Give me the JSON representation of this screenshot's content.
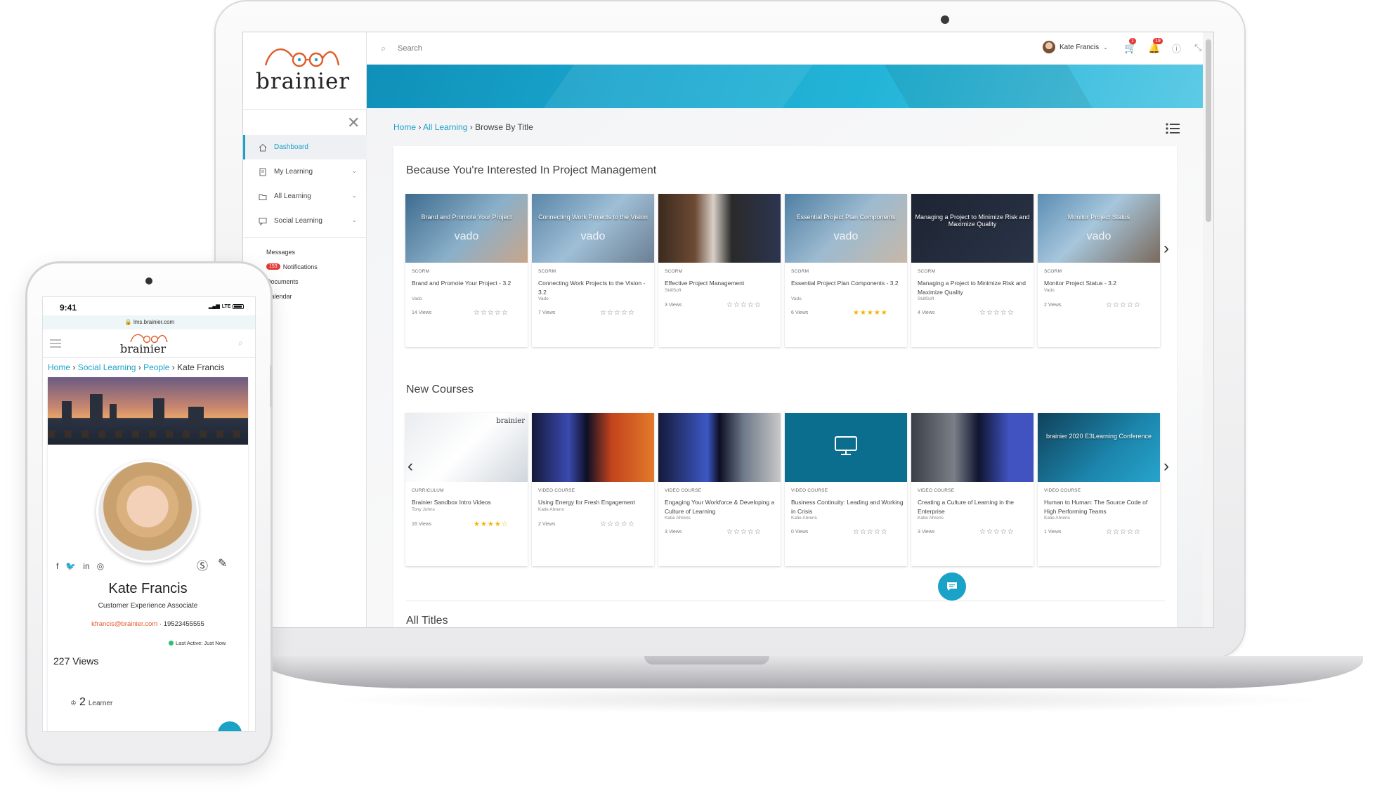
{
  "desktop": {
    "logo_text": "brainier",
    "search_placeholder": "Search",
    "user_name": "Kate Francis",
    "cart_badge": "1",
    "bell_badge": "19",
    "sidebar": {
      "items": [
        {
          "label": "Dashboard"
        },
        {
          "label": "My Learning"
        },
        {
          "label": "All Learning"
        },
        {
          "label": "Social Learning"
        }
      ],
      "messages": "Messages",
      "notifications_badge": "153",
      "notifications": "Notifications",
      "documents": "Documents",
      "calendar": "Calendar"
    },
    "breadcrumb": {
      "home": "Home",
      "all_learning": "All Learning",
      "current": "Browse By Title"
    },
    "section1": {
      "title": "Because You're Interested In Project Management",
      "cards": [
        {
          "caption": "Brand and Promote Your Project",
          "vado": "vado",
          "type": "SCORM",
          "title": "Brand and Promote Your Project - 3.2",
          "provider": "Vado",
          "views": "14 Views",
          "stars": "☆☆☆☆☆",
          "gold": false,
          "bg": "linear-gradient(135deg,#3d6b8f,#8bb0c9 55%,#c9a58a)"
        },
        {
          "caption": "Connecting Work Projects to the Vision",
          "vado": "vado",
          "type": "SCORM",
          "title": "Connecting Work Projects to the Vision - 3.2",
          "provider": "Vado",
          "views": "7 Views",
          "stars": "☆☆☆☆☆",
          "gold": false,
          "bg": "linear-gradient(135deg,#5a86a8,#9fbfd6 50%,#6b7f93)"
        },
        {
          "caption": "",
          "vado": "",
          "type": "SCORM",
          "title": "Effective Project Management",
          "provider": "SkillSoft",
          "views": "3 Views",
          "stars": "☆☆☆☆☆",
          "gold": false,
          "bg": "linear-gradient(90deg,#3b2a1e,#6d4a34 30%,#d8d0c8 45%,#2a2a2a 60%,#2c3550)"
        },
        {
          "caption": "Essential Project Plan Components",
          "vado": "vado",
          "type": "SCORM",
          "title": "Essential Project Plan Components - 3.2",
          "provider": "Vado",
          "views": "6 Views",
          "stars": "★★★★★",
          "gold": true,
          "bg": "linear-gradient(135deg,#4f7fa3,#9cbad0 50%,#c8b8a8)"
        },
        {
          "caption": "Managing a Project to Minimize Risk and Maximize Quality",
          "vado": "",
          "type": "SCORM",
          "title": "Managing a Project to Minimize Risk and Maximize Quality",
          "provider": "SkillSoft",
          "views": "4 Views",
          "stars": "☆☆☆☆☆",
          "gold": false,
          "bg": "linear-gradient(135deg,#1d2433,#2a3447)"
        },
        {
          "caption": "Monitor Project Status",
          "vado": "vado",
          "type": "SCORM",
          "title": "Monitor Project Status - 3.2",
          "provider": "Vado",
          "views": "2 Views",
          "stars": "☆☆☆☆☆",
          "gold": false,
          "bg": "linear-gradient(135deg,#5b8db3,#a6c6dc 45%,#7a6a5c)"
        }
      ]
    },
    "section2": {
      "title": "New Courses",
      "cards": [
        {
          "caption": "",
          "vado": "",
          "type": "CURRICULUM",
          "title": "Brainier Sandbox Intro Videos",
          "provider": "Tony Johns",
          "views": "16 Views",
          "stars": "★★★★☆",
          "gold": true,
          "bg": "linear-gradient(135deg,#e9ecef,#ffffff 50%,#cfd6dc)"
        },
        {
          "caption": "",
          "vado": "",
          "type": "VIDEO COURSE",
          "title": "Using Energy for Fresh Engagement",
          "provider": "Katie Ahrens",
          "views": "2 Views",
          "stars": "☆☆☆☆☆",
          "gold": false,
          "bg": "linear-gradient(90deg,#141a3a,#3a4ab0 30%,#0d0f24 45%,#c2431d 65%,#e37a2a)"
        },
        {
          "caption": "",
          "vado": "",
          "type": "VIDEO COURSE",
          "title": "Engaging Your Workforce & Developing a Culture of Learning",
          "provider": "Katie Ahrens",
          "views": "3 Views",
          "stars": "☆☆☆☆☆",
          "gold": false,
          "bg": "linear-gradient(90deg,#141a3a,#3d58c4 40%,#0d0f24 50%,#6f7a8a 70%,#c8c8c8)"
        },
        {
          "caption": "",
          "vado": "",
          "type": "VIDEO COURSE",
          "title": "Business Continuity: Leading and Working in Crisis",
          "provider": "Katie Ahrens",
          "views": "0 Views",
          "stars": "☆☆☆☆☆",
          "gold": false,
          "bg": "#0c6e8e"
        },
        {
          "caption": "",
          "vado": "",
          "type": "VIDEO COURSE",
          "title": "Creating a Culture of Learning in the Enterprise",
          "provider": "Katie Ahrens",
          "views": "3 Views",
          "stars": "☆☆☆☆☆",
          "gold": false,
          "bg": "linear-gradient(90deg,#3a3e47,#7a7f88 35%,#101530 55%,#4053c0 80%)"
        },
        {
          "caption": "brainier 2020 E3Learning Conference",
          "vado": "",
          "type": "VIDEO COURSE",
          "title": "Human to Human: The Source Code of High Performing Teams",
          "provider": "Katie Ahrens",
          "views": "1 Views",
          "stars": "☆☆☆☆☆",
          "gold": false,
          "bg": "linear-gradient(135deg,#10415a,#1c86ad 60%,#27a4cc)"
        }
      ]
    },
    "all_titles": "All Titles",
    "card_watermark": "brainier"
  },
  "mobile": {
    "time": "9:41",
    "network": "LTE",
    "url": "lms.brainier.com",
    "logo_text": "brainier",
    "breadcrumb": {
      "home": "Home",
      "social": "Social Learning",
      "people": "People",
      "current": "Kate Francis"
    },
    "name": "Kate Francis",
    "role": "Customer Experience Associate",
    "email": "kfrancis@brainier.com",
    "phone": "19523455555",
    "last_active": "Last Active: Just Now",
    "views": "227 Views",
    "learner_count": "2",
    "learner_label": "Learner"
  },
  "colors": {
    "accent": "#1ba2c7",
    "badge": "#e53935",
    "star_gold": "#f5b400",
    "email": "#e05a2b"
  }
}
